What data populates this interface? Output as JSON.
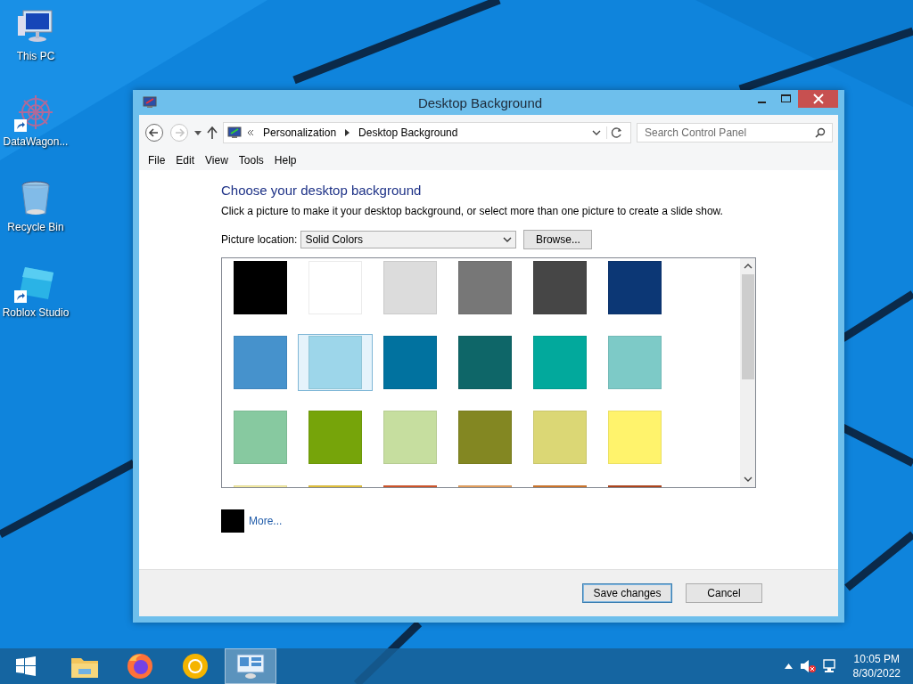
{
  "desktop_icons": [
    {
      "label": "This PC",
      "kind": "pc",
      "shortcut": false
    },
    {
      "label": "DataWagon...",
      "kind": "gear",
      "shortcut": true
    },
    {
      "label": "Recycle Bin",
      "kind": "bin",
      "shortcut": false
    },
    {
      "label": "Roblox Studio",
      "kind": "studio",
      "shortcut": true
    }
  ],
  "window": {
    "title": "Desktop Background",
    "address": {
      "path": [
        "Personalization",
        "Desktop Background"
      ]
    },
    "search": {
      "placeholder": "Search Control Panel"
    },
    "menu": [
      "File",
      "Edit",
      "View",
      "Tools",
      "Help"
    ],
    "heading": "Choose your desktop background",
    "description": "Click a picture to make it your desktop background, or select more than one picture to create a slide show.",
    "picture_location": {
      "label": "Picture location:",
      "value": "Solid Colors",
      "browse": "Browse..."
    },
    "swatch_rows": [
      [
        {
          "color": "#000000",
          "selected": false
        },
        {
          "color": "#ffffff",
          "selected": false
        },
        {
          "color": "#dcdcdc",
          "selected": false
        },
        {
          "color": "#777777",
          "selected": false
        },
        {
          "color": "#464646",
          "selected": false
        },
        {
          "color": "#0c3775",
          "selected": false
        }
      ],
      [
        {
          "color": "#4692cc",
          "selected": false
        },
        {
          "color": "#9dd6ea",
          "selected": true
        },
        {
          "color": "#01729f",
          "selected": false
        },
        {
          "color": "#0e6668",
          "selected": false
        },
        {
          "color": "#02a99c",
          "selected": false
        },
        {
          "color": "#7dcac7",
          "selected": false
        }
      ],
      [
        {
          "color": "#87c9a0",
          "selected": false
        },
        {
          "color": "#76a40a",
          "selected": false
        },
        {
          "color": "#c6de9f",
          "selected": false
        },
        {
          "color": "#838722",
          "selected": false
        },
        {
          "color": "#dbd775",
          "selected": false
        },
        {
          "color": "#fff36c",
          "selected": false
        }
      ],
      [
        {
          "color": "#f6eda0",
          "selected": false
        },
        {
          "color": "#e6c43a",
          "selected": false
        },
        {
          "color": "#d4562a",
          "selected": false
        },
        {
          "color": "#e9a25e",
          "selected": false
        },
        {
          "color": "#d2772a",
          "selected": false
        },
        {
          "color": "#b3461c",
          "selected": false
        }
      ]
    ],
    "more": {
      "color": "#000000",
      "label": "More..."
    },
    "buttons": [
      {
        "label": "Save changes",
        "kind": "default"
      },
      {
        "label": "Cancel",
        "kind": "normal"
      }
    ]
  },
  "taskbar": {
    "apps": [
      {
        "kind": "explorer",
        "selected": false
      },
      {
        "kind": "firefox",
        "selected": false
      },
      {
        "kind": "browser",
        "selected": false
      },
      {
        "kind": "control",
        "selected": true
      }
    ],
    "time": "10:05 PM",
    "date": "8/30/2022"
  }
}
